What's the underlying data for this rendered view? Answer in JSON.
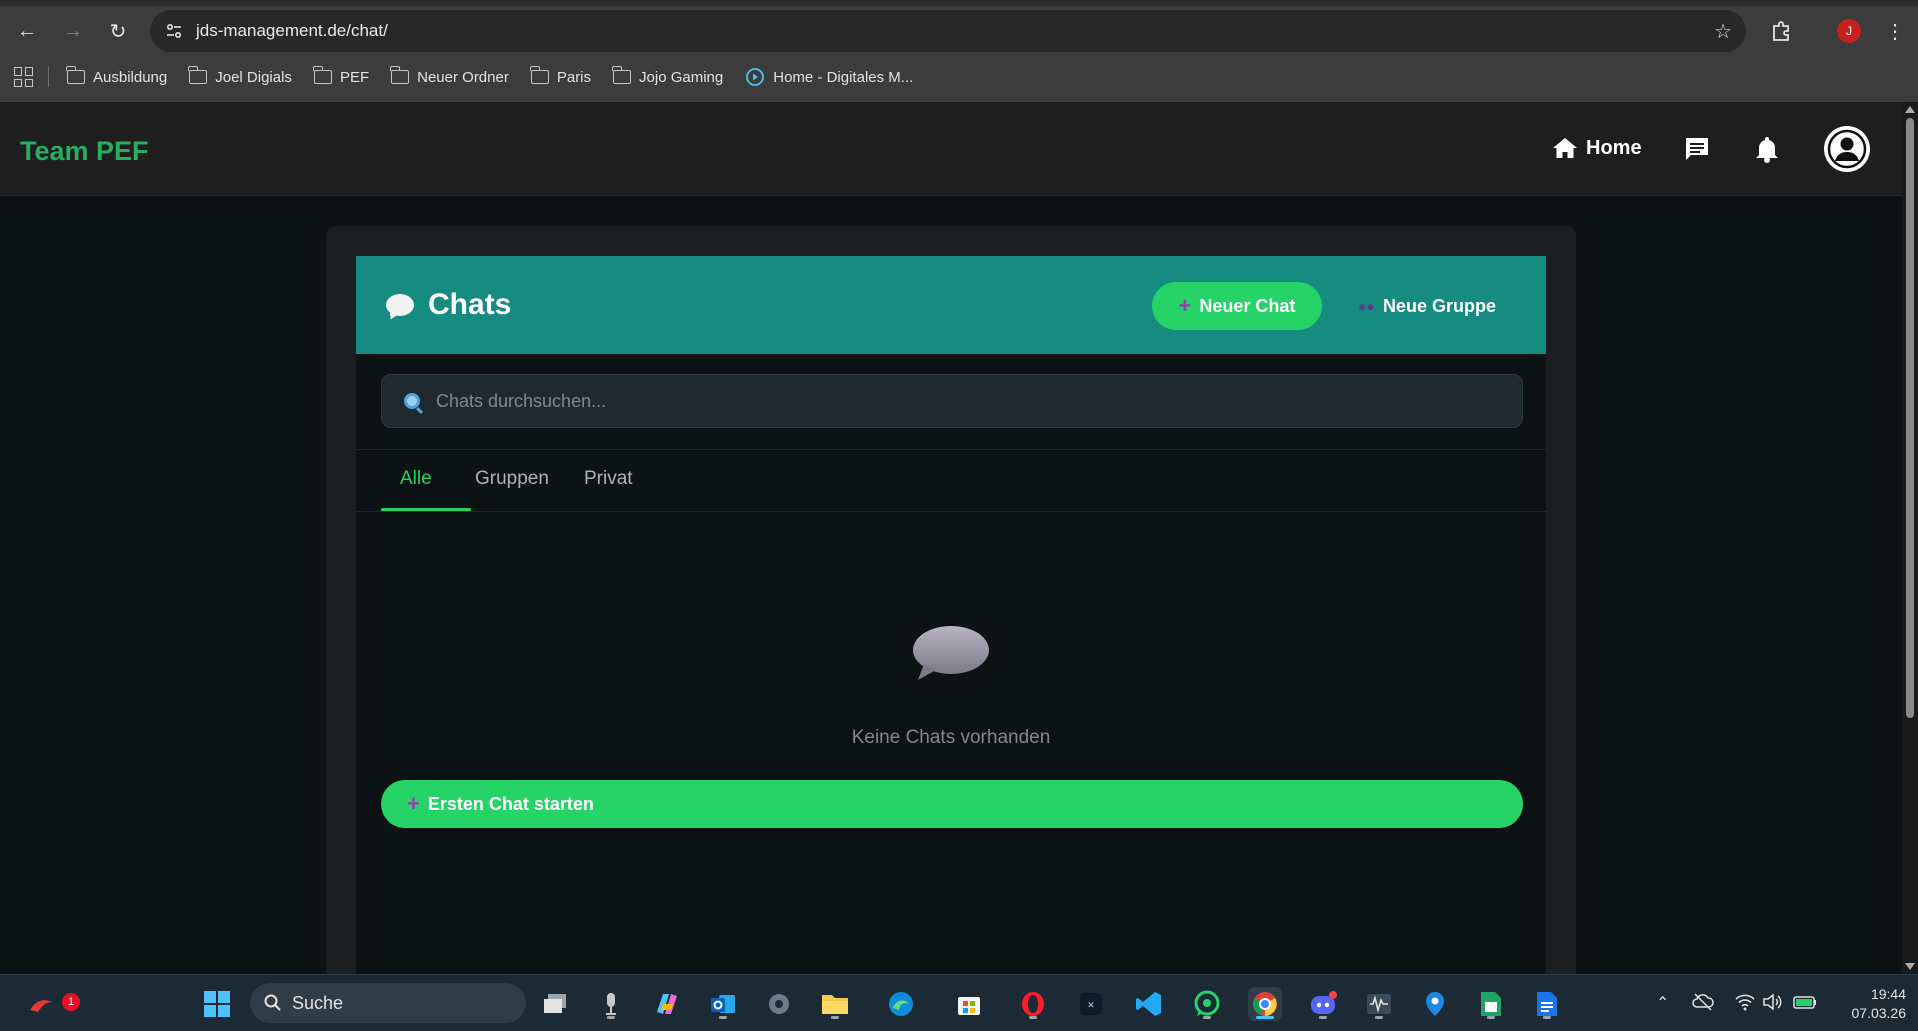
{
  "browser": {
    "url": "jds-management.de/chat/",
    "profile_initial": "J",
    "bookmarks": [
      {
        "label": "Ausbildung",
        "icon": "folder-icon"
      },
      {
        "label": "Joel Digials",
        "icon": "folder-icon"
      },
      {
        "label": "PEF",
        "icon": "folder-icon"
      },
      {
        "label": "Neuer Ordner",
        "icon": "folder-icon"
      },
      {
        "label": "Paris",
        "icon": "folder-icon"
      },
      {
        "label": "Jojo Gaming",
        "icon": "folder-icon"
      },
      {
        "label": "Home - Digitales M...",
        "icon": "play-circle-icon"
      }
    ]
  },
  "header": {
    "brand": "Team PEF",
    "home_label": "Home",
    "brand_color": "#27ae60"
  },
  "chat": {
    "title": "Chats",
    "new_chat_label": "Neuer Chat",
    "new_group_label": "Neue Gruppe",
    "search_placeholder": "Chats durchsuchen...",
    "tabs": [
      {
        "label": "Alle",
        "active": true
      },
      {
        "label": "Gruppen",
        "active": false
      },
      {
        "label": "Privat",
        "active": false
      }
    ],
    "empty_text": "Keine Chats vorhanden",
    "first_chat_label": "Ersten Chat starten",
    "accent_color": "#25d366",
    "header_color": "#168b7f"
  },
  "taskbar": {
    "search_label": "Suche",
    "notification_count": "1",
    "time": "19:44",
    "date": "07.03.26"
  }
}
